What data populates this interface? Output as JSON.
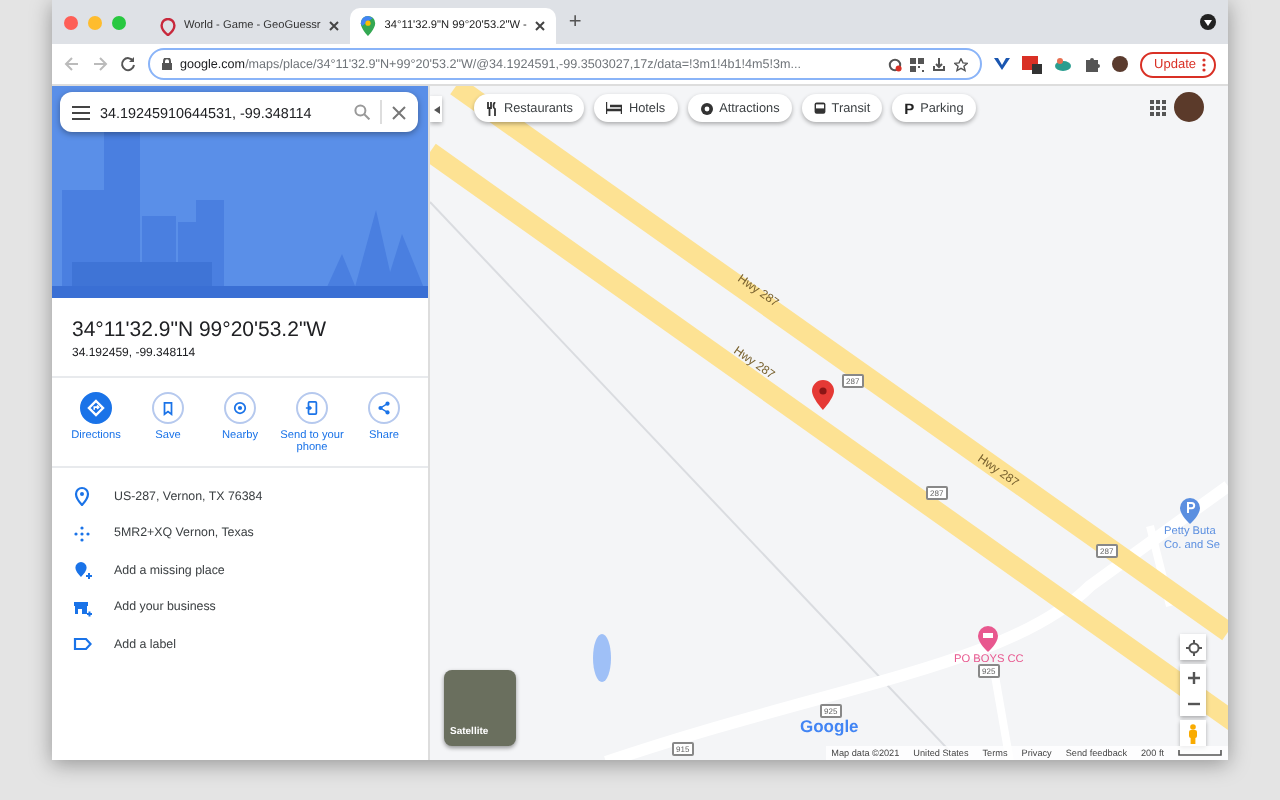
{
  "browser": {
    "tabs": [
      {
        "title": "World - Game - GeoGuessr",
        "kind": "geoguessr",
        "selected": false
      },
      {
        "title": "34°11'32.9\"N 99°20'53.2\"W -",
        "kind": "maps",
        "selected": true
      }
    ],
    "new_tab": "+",
    "url": {
      "host": "google.com",
      "path": "/maps/place/34°11'32.9\"N+99°20'53.2\"W/@34.1924591,-99.3503027,17z/data=!3m1!4b1!4m5!3m..."
    },
    "update_button": "Update"
  },
  "sidebar": {
    "search": {
      "value": "34.19245910644531, -99.348114"
    },
    "title": "34°11'32.9\"N 99°20'53.2\"W",
    "coordinates": "34.192459, -99.348114",
    "actions": [
      {
        "kind": "directions",
        "label": "Directions",
        "primary": true
      },
      {
        "kind": "save",
        "label": "Save",
        "primary": false
      },
      {
        "kind": "nearby",
        "label": "Nearby",
        "primary": false
      },
      {
        "kind": "phone",
        "label": "Send to your phone",
        "primary": false
      },
      {
        "kind": "share",
        "label": "Share",
        "primary": false
      }
    ],
    "details": [
      {
        "kind": "address",
        "text": "US-287, Vernon, TX 76384"
      },
      {
        "kind": "plus-code",
        "text": "5MR2+XQ Vernon, Texas"
      },
      {
        "kind": "add-place",
        "text": "Add a missing place"
      },
      {
        "kind": "add-business",
        "text": "Add your business"
      },
      {
        "kind": "label",
        "text": "Add a label"
      }
    ]
  },
  "map": {
    "chips": [
      {
        "kind": "restaurants",
        "label": "Restaurants"
      },
      {
        "kind": "hotels",
        "label": "Hotels"
      },
      {
        "kind": "attractions",
        "label": "Attractions"
      },
      {
        "kind": "transit",
        "label": "Transit"
      },
      {
        "kind": "parking",
        "label": "Parking",
        "glyph": "P"
      }
    ],
    "road_labels": [
      "Hwy 287",
      "Hwy 287",
      "Hwy 287"
    ],
    "shields": [
      "287",
      "287",
      "287",
      "925",
      "925",
      "915"
    ],
    "places": [
      {
        "kind": "pink",
        "name_lines": [
          "PO BOYS CC"
        ],
        "color": "#e8588f"
      },
      {
        "kind": "blue",
        "name_lines": [
          "Petty Buta",
          "Co. and Se"
        ],
        "color": "#5b8fe0"
      }
    ],
    "satellite_label": "Satellite",
    "logo": "Google",
    "footer": [
      "Map data ©2021",
      "United States",
      "Terms",
      "Privacy",
      "Send feedback",
      "200 ft"
    ]
  }
}
